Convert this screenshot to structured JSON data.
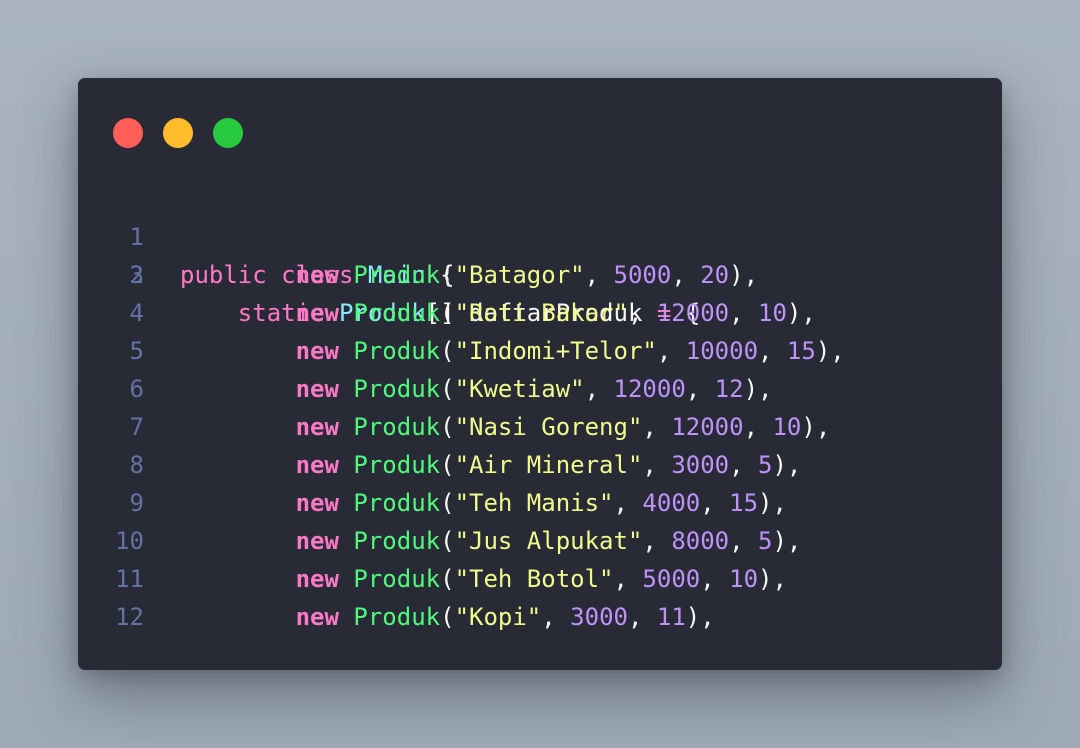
{
  "window": {
    "traffic_lights": [
      "close-dot",
      "minimize-dot",
      "zoom-dot"
    ],
    "colors": {
      "background": "#282a36",
      "close": "#ff5f56",
      "minimize": "#ffbd2e",
      "zoom": "#27c93f"
    }
  },
  "code": {
    "line_numbers": [
      "1",
      "2",
      "3",
      "4",
      "5",
      "6",
      "7",
      "8",
      "9",
      "10",
      "11",
      "12"
    ],
    "header": {
      "l1": {
        "kw1": "public",
        "kw2": "class",
        "name": "Main",
        "brace": "{"
      },
      "l2": {
        "kw": "static",
        "type": "Produk",
        "rest": "[] daftarProduk ",
        "eq": "=",
        "brace": " {"
      }
    },
    "items": [
      {
        "name": "\"Batagor\"",
        "price": "5000",
        "qty": "20"
      },
      {
        "name": "\"Roti Bakar\"",
        "price": "12000",
        "qty": "10"
      },
      {
        "name": "\"Indomi+Telor\"",
        "price": "10000",
        "qty": "15"
      },
      {
        "name": "\"Kwetiaw\"",
        "price": "12000",
        "qty": "12"
      },
      {
        "name": "\"Nasi Goreng\"",
        "price": "12000",
        "qty": "10"
      },
      {
        "name": "\"Air Mineral\"",
        "price": "3000",
        "qty": "5"
      },
      {
        "name": "\"Teh Manis\"",
        "price": "4000",
        "qty": "15"
      },
      {
        "name": "\"Jus Alpukat\"",
        "price": "8000",
        "qty": "5"
      },
      {
        "name": "\"Teh Botol\"",
        "price": "5000",
        "qty": "10"
      },
      {
        "name": "\"Kopi\"",
        "price": "3000",
        "qty": "11"
      }
    ],
    "tokens": {
      "new_kw": "new",
      "class_name": "Produk",
      "open_paren": "(",
      "sep": ", ",
      "close_paren": "),"
    },
    "syntax_colors": {
      "keyword": "#ff79c6",
      "type": "#8be9fd",
      "class": "#50fa7b",
      "string": "#f1fa8c",
      "number": "#bd93f9",
      "plain": "#f8f8f2",
      "line_number": "#6272a4"
    }
  }
}
